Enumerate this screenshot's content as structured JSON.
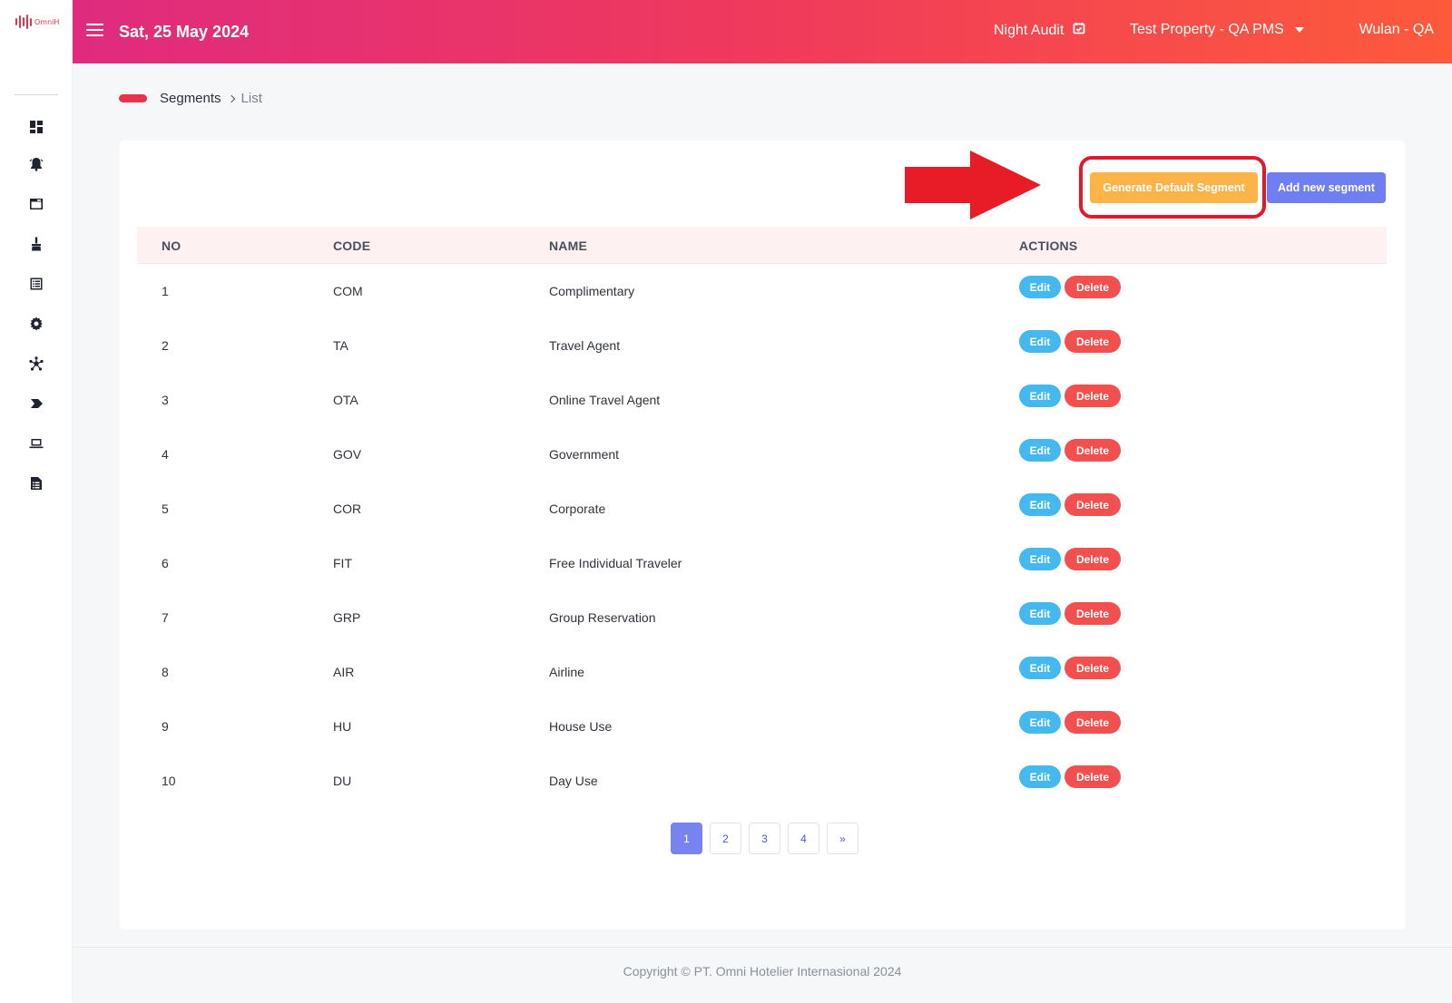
{
  "brand": {
    "logo_text": "OmniH",
    "accent": "#e3364c"
  },
  "header": {
    "date": "Sat, 25 May 2024",
    "night_audit": "Night Audit",
    "property": "Test Property - QA PMS",
    "user": "Wulan - QA",
    "gradient": [
      "#df2b7e",
      "#ef3a5c",
      "#fd5a3b"
    ]
  },
  "sidebar": {
    "items": [
      {
        "icon": "dashboard-icon"
      },
      {
        "icon": "bell-icon"
      },
      {
        "icon": "window-icon"
      },
      {
        "icon": "broom-icon"
      },
      {
        "icon": "list-icon"
      },
      {
        "icon": "gear-icon"
      },
      {
        "icon": "network-icon"
      },
      {
        "icon": "tag-icon"
      },
      {
        "icon": "laptop-icon"
      },
      {
        "icon": "report-icon"
      }
    ]
  },
  "breadcrumb": {
    "first": "Segments",
    "current": "List"
  },
  "toolbar": {
    "generate_label": "Generate Default Segment",
    "add_label": "Add new segment"
  },
  "table": {
    "columns": [
      "NO",
      "CODE",
      "NAME",
      "ACTIONS"
    ],
    "edit_label": "Edit",
    "delete_label": "Delete",
    "rows": [
      {
        "no": "1",
        "code": "COM",
        "name": "Complimentary"
      },
      {
        "no": "2",
        "code": "TA",
        "name": "Travel Agent"
      },
      {
        "no": "3",
        "code": "OTA",
        "name": "Online Travel Agent"
      },
      {
        "no": "4",
        "code": "GOV",
        "name": "Government"
      },
      {
        "no": "5",
        "code": "COR",
        "name": "Corporate"
      },
      {
        "no": "6",
        "code": "FIT",
        "name": "Free Individual Traveler"
      },
      {
        "no": "7",
        "code": "GRP",
        "name": "Group Reservation"
      },
      {
        "no": "8",
        "code": "AIR",
        "name": "Airline"
      },
      {
        "no": "9",
        "code": "HU",
        "name": "House Use"
      },
      {
        "no": "10",
        "code": "DU",
        "name": "Day Use"
      }
    ]
  },
  "pagination": {
    "pages": [
      "1",
      "2",
      "3",
      "4",
      "»"
    ],
    "active": "1"
  },
  "footer": {
    "copyright": "Copyright © PT. Omni Hotelier Internasional 2024"
  }
}
